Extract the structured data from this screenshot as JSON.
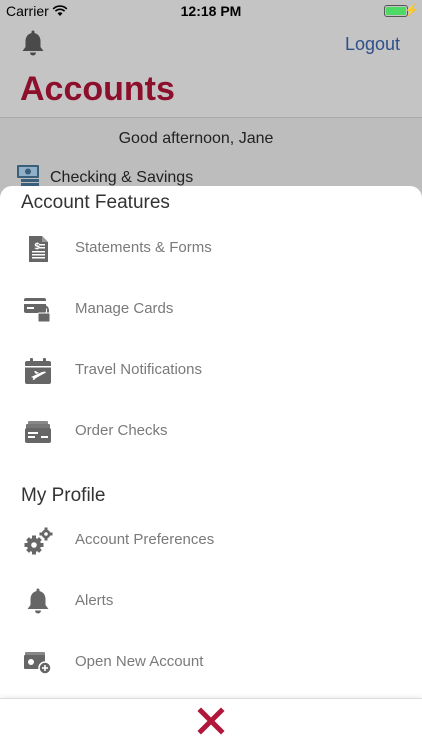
{
  "status_bar": {
    "carrier": "Carrier",
    "time": "12:18 PM"
  },
  "header": {
    "logout_label": "Logout",
    "title": "Accounts"
  },
  "greeting": "Good afternoon, Jane",
  "account_row_label": "Checking & Savings",
  "sheet": {
    "account_features_title": "Account Features",
    "account_features": [
      {
        "label": "Statements & Forms",
        "icon": "statement-document-icon"
      },
      {
        "label": "Manage Cards",
        "icon": "card-lock-icon"
      },
      {
        "label": "Travel Notifications",
        "icon": "calendar-plane-icon"
      },
      {
        "label": "Order Checks",
        "icon": "checks-stack-icon"
      }
    ],
    "my_profile_title": "My Profile",
    "my_profile": [
      {
        "label": "Account Preferences",
        "icon": "gears-icon"
      },
      {
        "label": "Alerts",
        "icon": "bell-icon"
      },
      {
        "label": "Open New Account",
        "icon": "card-plus-icon"
      }
    ]
  },
  "colors": {
    "brand_red": "#8c0f2c",
    "close_x": "#b0173a",
    "link_blue": "#2e4f8a"
  }
}
